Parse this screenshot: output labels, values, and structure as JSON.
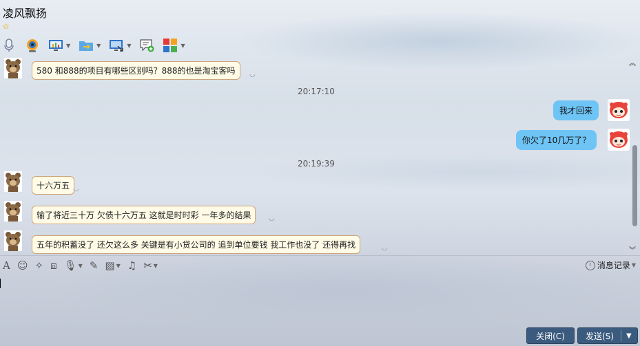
{
  "window": {
    "title": "凌风飘扬"
  },
  "toolbar": {
    "items": [
      {
        "icon": "microphone-icon",
        "has_dropdown": false
      },
      {
        "icon": "webcam-icon",
        "has_dropdown": false
      },
      {
        "icon": "screen-share-icon",
        "has_dropdown": true
      },
      {
        "icon": "file-transfer-icon",
        "has_dropdown": true
      },
      {
        "icon": "remote-desktop-icon",
        "has_dropdown": true
      },
      {
        "icon": "add-chat-icon",
        "has_dropdown": false
      },
      {
        "icon": "apps-icon",
        "has_dropdown": true
      }
    ]
  },
  "chat": {
    "messages": [
      {
        "side": "left",
        "text": "580 和888的项目有哪些区别吗？888的也是淘宝客吗"
      },
      {
        "timestamp": "20:17:10"
      },
      {
        "side": "right",
        "text": "我才回来"
      },
      {
        "side": "right",
        "text": "你欠了10几万了？"
      },
      {
        "timestamp": "20:19:39"
      },
      {
        "side": "left",
        "text": "十六万五"
      },
      {
        "side": "left",
        "text": "输了将近三十万 欠债十六万五 这就是时时彩 一年多的结果"
      },
      {
        "side": "left",
        "text": "五年的积蓄没了 还欠这么多 关键是有小贷公司的 追到单位要钱 我工作也没了 还得再找"
      }
    ]
  },
  "input_toolbar": {
    "items": [
      "font-icon",
      "emoji-icon",
      "magic-icon",
      "shake-icon",
      "voice-icon",
      "edit-icon",
      "image-icon",
      "music-icon",
      "scissors-icon"
    ],
    "history_label": "消息记录"
  },
  "buttons": {
    "close_label": "关闭(C)",
    "send_label": "发送(S)"
  },
  "colors": {
    "left_bubble_bg": "#fffbe6",
    "left_bubble_border": "#cfa57a",
    "right_bubble_bg": "#6ec4f5",
    "button_bg": "#3b5b7e"
  }
}
